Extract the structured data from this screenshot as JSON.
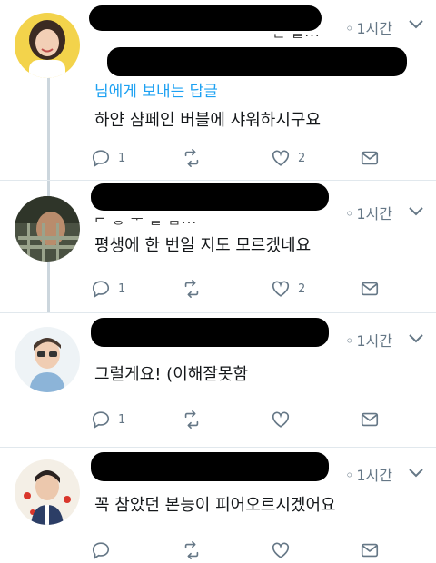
{
  "tweets": [
    {
      "time": "1시간",
      "reply_prefix": "님에게 보내는 답글",
      "text": "하얀 샴페인 버블에 샤워하시구요",
      "reply_count": "1",
      "like_count": "2"
    },
    {
      "time": "1시간",
      "text": "평생에 한 번일 지도 모르겠네요",
      "reply_count": "1",
      "like_count": "2"
    },
    {
      "time": "1시간",
      "text": "그럴게요! (이해잘못함",
      "reply_count": "1",
      "like_count": ""
    },
    {
      "time": "1시간",
      "text": "꼭 참았던 본능이 피어오르시겠어요",
      "reply_count": "",
      "like_count": ""
    }
  ],
  "icons": {
    "reply": "reply-icon",
    "retweet": "retweet-icon",
    "like": "heart-icon",
    "message": "envelope-icon",
    "caret": "chevron-down-icon"
  },
  "colors": {
    "link": "#1da1f2",
    "meta": "#657786",
    "thread_line": "#ccd6dd"
  }
}
